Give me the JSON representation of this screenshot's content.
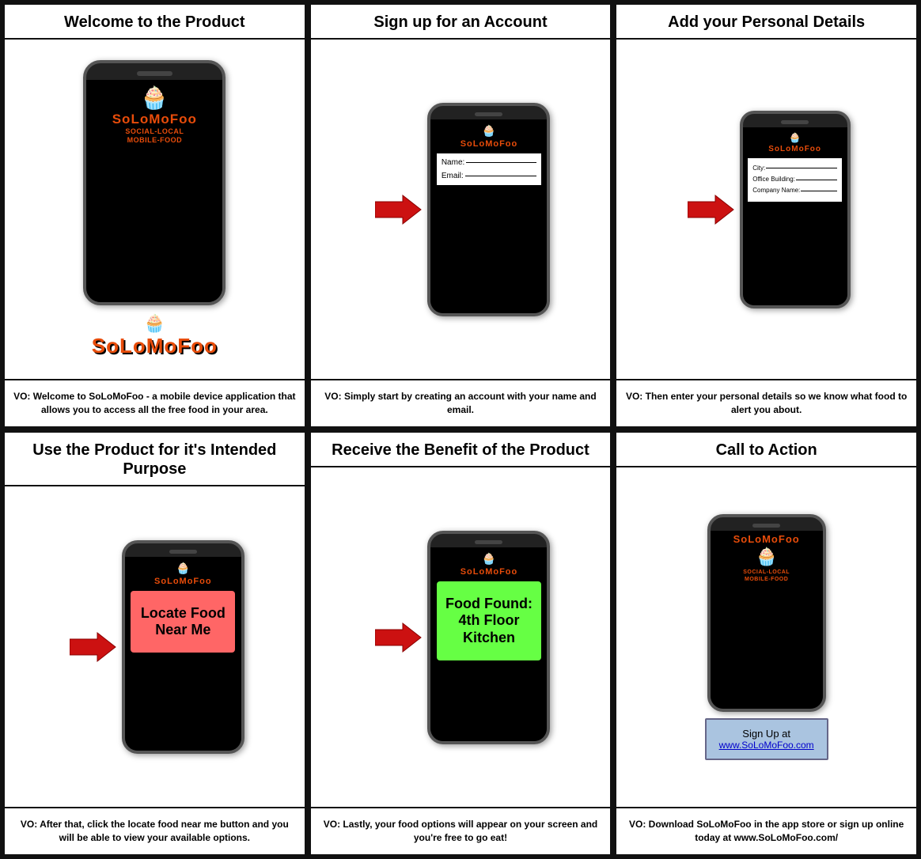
{
  "grid": {
    "cells": [
      {
        "id": "cell1",
        "header": "Welcome to the Product",
        "footer": "VO: Welcome to SoLoMoFoo - a mobile device application that allows you to access all the free food in your area.",
        "logo": "SoLoMoFoo",
        "logo_subtitle_line1": "SOCIAL-LOCAL",
        "logo_subtitle_line2": "MOBILE-FOOD"
      },
      {
        "id": "cell2",
        "header": "Sign up for an Account",
        "footer": "VO: Simply start by creating an account with your name and email.",
        "form_name_label": "Name:",
        "form_email_label": "Email:"
      },
      {
        "id": "cell3",
        "header": "Add your Personal Details",
        "footer": "VO: Then enter your personal details so we know what food to alert you about.",
        "field1_label": "City:",
        "field2_label": "Office Building:",
        "field3_label": "Company Name:"
      },
      {
        "id": "cell4",
        "header": "Use the Product for it's Intended Purpose",
        "footer": "VO: After that, click the locate food near me button and you will be able to view your available options.",
        "button_text": "Locate Food\nNear Me"
      },
      {
        "id": "cell5",
        "header": "Receive the Benefit of the Product",
        "footer": "VO: Lastly, your food options will appear on your screen and you're free to go eat!",
        "found_text": "Food Found:\n4th Floor\nKitchen"
      },
      {
        "id": "cell6",
        "header": "Call to Action",
        "footer": "VO: Download SoLoMoFoo in the app store or sign up online today at www.SoLoMoFoo.com/",
        "cta_line1": "Sign Up at",
        "cta_link": "www.SoLoMoFoo.com",
        "logo": "SoLoMoFoo",
        "logo_subtitle_line1": "SOCIAL-LOCAL",
        "logo_subtitle_line2": "MOBILE-FOOD"
      }
    ]
  }
}
